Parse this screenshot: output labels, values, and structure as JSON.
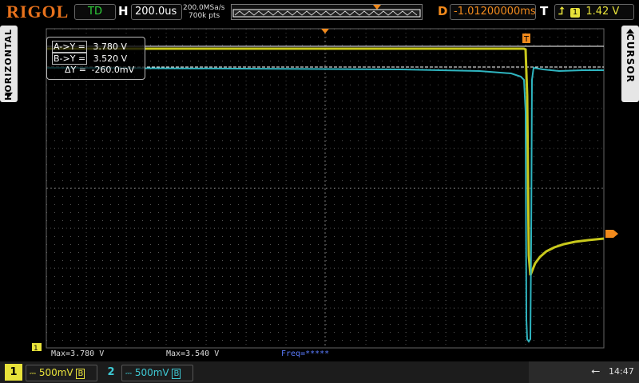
{
  "topbar": {
    "brand": "RIGOL",
    "run_state": "TD",
    "horizontal_label": "H",
    "timebase": "200.0us",
    "sample_rate": "200.0MSa/s",
    "memory_depth": "700k pts",
    "delay_label": "D",
    "delay": "-1.01200000ms",
    "trigger_label": "T",
    "trigger_source": "1",
    "trigger_level": "1.42 V"
  },
  "left_tab": {
    "label": "HORIZONTAL"
  },
  "right_tab": {
    "label": "CURSOR"
  },
  "cursor_readout": {
    "a_tag": "A->Y =",
    "a_value": "3.780 V",
    "b_tag": "B->Y =",
    "b_value": "3.520 V",
    "delta_tag": "ΔY =",
    "delta_value": "-260.0mV"
  },
  "measurements": {
    "m1": "Max=3.780 V",
    "m2": "Max=3.540 V",
    "m3": "Freq=*****"
  },
  "channels": [
    {
      "number": "1",
      "scale": "500mV",
      "color": "#e8e23a"
    },
    {
      "number": "2",
      "scale": "500mV",
      "color": "#3ec9d4"
    }
  ],
  "status": {
    "time": "14:47"
  },
  "colors": {
    "ch1": "#c8c81c",
    "ch2": "#2fb5c0",
    "trigger": "#f28a1c",
    "brand": "#e8721c"
  },
  "markers": {
    "ch1_ground": "1",
    "trigger_marker": "T"
  }
}
